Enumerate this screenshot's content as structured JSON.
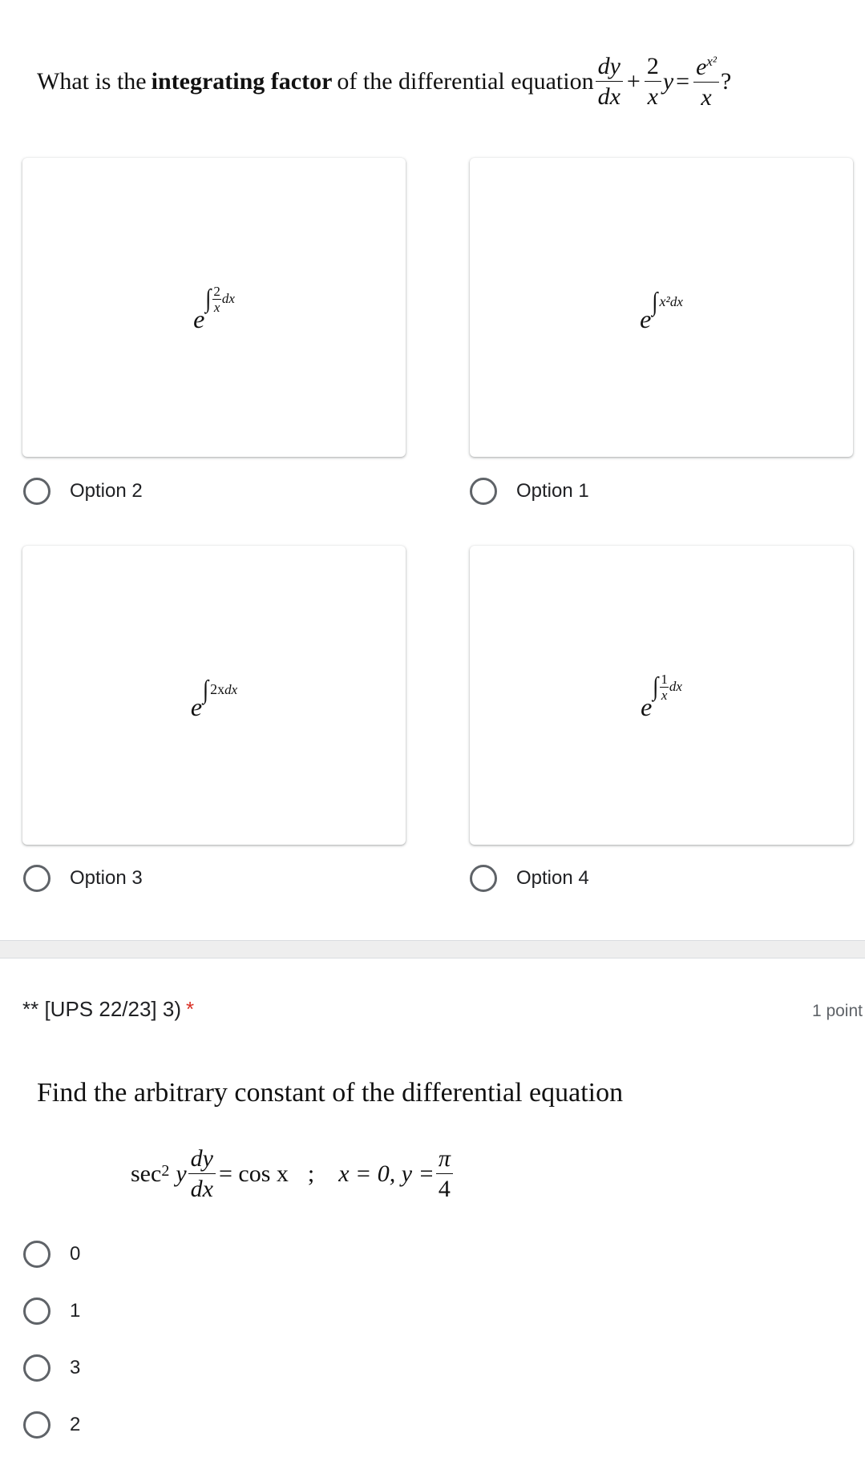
{
  "question1": {
    "title_prefix": "What is the ",
    "title_bold": "integrating factor",
    "title_suffix": " of the differential equation",
    "equation": {
      "term1_num": "dy",
      "term1_den": "dx",
      "plus": "+",
      "term2_num": "2",
      "term2_den": "x",
      "y": "y",
      "equals": "=",
      "rhs_num_base": "e",
      "rhs_num_exp": "x²",
      "rhs_den": "x",
      "question_mark": "?"
    },
    "options": [
      {
        "label": "Option 2",
        "math": {
          "base": "e",
          "integral": "∫",
          "frac_num": "2",
          "frac_den": "x",
          "tail": "dx"
        }
      },
      {
        "label": "Option 1",
        "math": {
          "base": "e",
          "integral": "∫",
          "expr": "x²",
          "tail": "dx"
        }
      },
      {
        "label": "Option 3",
        "math": {
          "base": "e",
          "integral": "∫",
          "expr": "2x",
          "tail": "dx"
        }
      },
      {
        "label": "Option 4",
        "math": {
          "base": "e",
          "integral": "∫",
          "frac_num": "1",
          "frac_den": "x",
          "tail": "dx"
        }
      }
    ]
  },
  "question2": {
    "header": "** [UPS 22/23] 3)",
    "required_mark": "*",
    "points": "1 point",
    "prompt": "Find the arbitrary constant of the differential equation",
    "equation": {
      "sec": "sec",
      "sec_exp": "2",
      "y": "y",
      "frac_num": "dy",
      "frac_den": "dx",
      "rhs": "= cos x",
      "separator": ";",
      "condition": "x = 0, y =",
      "cond_num": "π",
      "cond_den": "4"
    },
    "options": [
      {
        "label": "0"
      },
      {
        "label": "1"
      },
      {
        "label": "3"
      },
      {
        "label": "2"
      }
    ]
  },
  "colors": {
    "required": "#d93025",
    "radio_border": "#5f6368",
    "divider": "#eeeeee"
  }
}
